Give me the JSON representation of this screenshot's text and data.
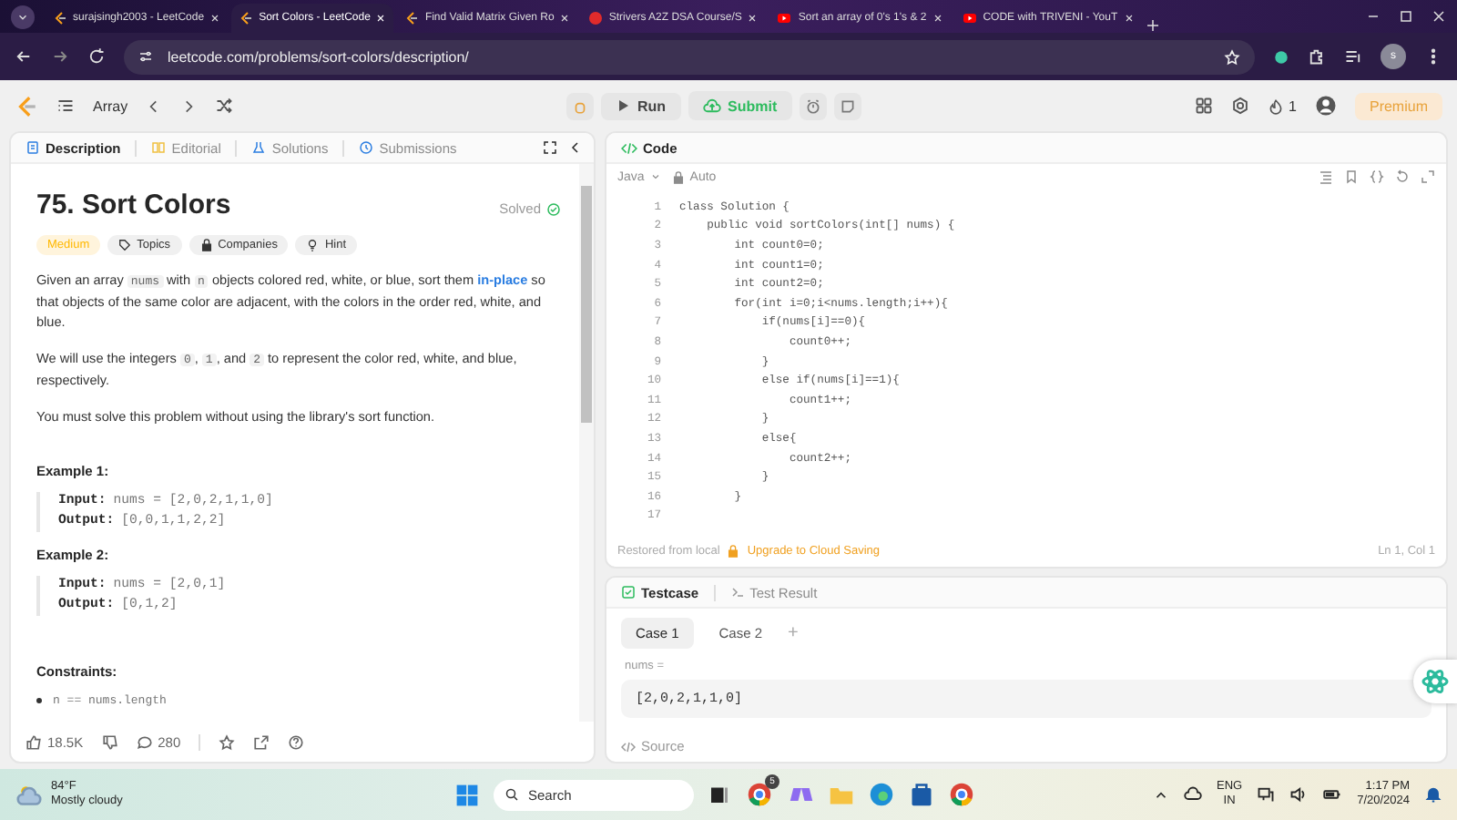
{
  "browser": {
    "tabs": [
      {
        "title": "surajsingh2003 - LeetCode",
        "kind": "leetcode",
        "selected": false
      },
      {
        "title": "Sort Colors - LeetCode",
        "kind": "leetcode",
        "selected": true
      },
      {
        "title": "Find Valid Matrix Given Ro",
        "kind": "leetcode",
        "selected": false
      },
      {
        "title": "Strivers A2Z DSA Course/S",
        "kind": "tuf",
        "selected": false
      },
      {
        "title": "Sort an array of 0's 1's & 2",
        "kind": "youtube",
        "selected": false
      },
      {
        "title": "CODE with TRIVENI - YouT",
        "kind": "youtube",
        "selected": false
      }
    ],
    "address": "leetcode.com/problems/sort-colors/description/",
    "profile": "s"
  },
  "nav": {
    "list_label": "Array",
    "run": "Run",
    "submit": "Submit",
    "streak": "1",
    "premium": "Premium"
  },
  "description": {
    "tabs": [
      {
        "label": "Description",
        "kind": "description",
        "selected": true
      },
      {
        "label": "Editorial",
        "kind": "editorial",
        "selected": false
      },
      {
        "label": "Solutions",
        "kind": "solutions",
        "selected": false
      },
      {
        "label": "Submissions",
        "kind": "submissions",
        "selected": false
      }
    ],
    "title": "75. Sort Colors",
    "status": "Solved",
    "tags": [
      {
        "label": "Medium",
        "kind": "difficulty"
      },
      {
        "label": "Topics",
        "kind": "topics"
      },
      {
        "label": "Companies",
        "kind": "companies"
      },
      {
        "label": "Hint",
        "kind": "hint"
      }
    ],
    "paragraphs": [
      [
        {
          "kind": "text",
          "text": "Given an array "
        },
        {
          "kind": "code",
          "text": "nums"
        },
        {
          "kind": "text",
          "text": " with "
        },
        {
          "kind": "code",
          "text": "n"
        },
        {
          "kind": "text",
          "text": " objects colored red, white, or blue, sort them "
        },
        {
          "kind": "link",
          "text": "in-place"
        },
        {
          "kind": "text",
          "text": " so that objects of the same color are adjacent, with the colors in the order red, white, and blue."
        }
      ],
      [
        {
          "kind": "text",
          "text": "We will use the integers "
        },
        {
          "kind": "code",
          "text": "0"
        },
        {
          "kind": "text",
          "text": ", "
        },
        {
          "kind": "code",
          "text": "1"
        },
        {
          "kind": "text",
          "text": ", and "
        },
        {
          "kind": "code",
          "text": "2"
        },
        {
          "kind": "text",
          "text": " to represent the color red, white, and blue, respectively."
        }
      ],
      [
        {
          "kind": "text",
          "text": "You must solve this problem without using the library's sort function."
        }
      ]
    ],
    "examples": [
      {
        "heading": "Example 1:",
        "input_label": "Input:",
        "input": "nums = [2,0,2,1,1,0]",
        "output_label": "Output:",
        "output": "[0,0,1,1,2,2]"
      },
      {
        "heading": "Example 2:",
        "input_label": "Input:",
        "input": "nums = [2,0,1]",
        "output_label": "Output:",
        "output": "[0,1,2]"
      }
    ],
    "constraints_heading": "Constraints:",
    "constraints": [
      "n == nums.length"
    ],
    "likes": "18.5K",
    "comments": "280"
  },
  "editor": {
    "title": "Code",
    "language": "Java",
    "mode": "Auto",
    "lines": [
      {
        "number": "1",
        "code": "class Solution {"
      },
      {
        "number": "2",
        "code": "    public void sortColors(int[] nums) {"
      },
      {
        "number": "3",
        "code": "        int count0=0;"
      },
      {
        "number": "4",
        "code": "        int count1=0;"
      },
      {
        "number": "5",
        "code": "        int count2=0;"
      },
      {
        "number": "6",
        "code": "        for(int i=0;i<nums.length;i++){"
      },
      {
        "number": "7",
        "code": "            if(nums[i]==0){"
      },
      {
        "number": "8",
        "code": "                count0++;"
      },
      {
        "number": "9",
        "code": "            }"
      },
      {
        "number": "10",
        "code": "            else if(nums[i]==1){"
      },
      {
        "number": "11",
        "code": "                count1++;"
      },
      {
        "number": "12",
        "code": "            }"
      },
      {
        "number": "13",
        "code": "            else{"
      },
      {
        "number": "14",
        "code": "                count2++;"
      },
      {
        "number": "15",
        "code": "            }"
      },
      {
        "number": "16",
        "code": "        }"
      },
      {
        "number": "17"
      }
    ],
    "saved_note": "Restored from local",
    "upgrade": "Upgrade to Cloud Saving",
    "cursor": "Ln 1, Col 1"
  },
  "testcase": {
    "tabs": [
      {
        "label": "Testcase",
        "kind": "testcase",
        "selected": true
      },
      {
        "label": "Test Result",
        "kind": "result",
        "selected": false
      }
    ],
    "cases": [
      {
        "label": "Case 1",
        "selected": true
      },
      {
        "label": "Case 2",
        "selected": false
      }
    ],
    "add": "+",
    "param_label": "nums =",
    "param_value": "[2,0,2,1,1,0]",
    "source": "Source"
  },
  "taskbar": {
    "temperature": "84°F",
    "weather": "Mostly cloudy",
    "search": "Search",
    "language": "ENG",
    "region": "IN",
    "time": "1:17 PM",
    "date": "7/20/2024",
    "chrome_badge": "5"
  }
}
